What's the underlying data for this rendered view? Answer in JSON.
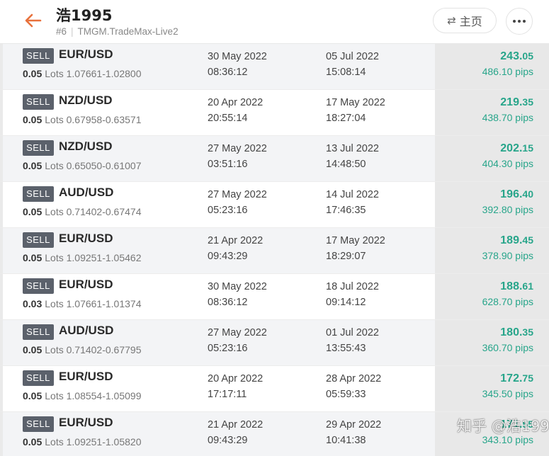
{
  "header": {
    "title": "浩1995",
    "account_id": "#6",
    "server": "TMGM.TradeMax-Live2",
    "home_label": "主页"
  },
  "trades": [
    {
      "side": "SELL",
      "pair": "EUR/USD",
      "lots": "0.05",
      "lots_label": "Lots",
      "prices": "1.07661-1.02800",
      "open_date": "30 May 2022",
      "open_time": "08:36:12",
      "close_date": "05 Jul 2022",
      "close_time": "15:08:14",
      "profit_int": "243.",
      "profit_dec": "05",
      "pips": "486.10 pips"
    },
    {
      "side": "SELL",
      "pair": "NZD/USD",
      "lots": "0.05",
      "lots_label": "Lots",
      "prices": "0.67958-0.63571",
      "open_date": "20 Apr 2022",
      "open_time": "20:55:14",
      "close_date": "17 May 2022",
      "close_time": "18:27:04",
      "profit_int": "219.",
      "profit_dec": "35",
      "pips": "438.70 pips"
    },
    {
      "side": "SELL",
      "pair": "NZD/USD",
      "lots": "0.05",
      "lots_label": "Lots",
      "prices": "0.65050-0.61007",
      "open_date": "27 May 2022",
      "open_time": "03:51:16",
      "close_date": "13 Jul 2022",
      "close_time": "14:48:50",
      "profit_int": "202.",
      "profit_dec": "15",
      "pips": "404.30 pips"
    },
    {
      "side": "SELL",
      "pair": "AUD/USD",
      "lots": "0.05",
      "lots_label": "Lots",
      "prices": "0.71402-0.67474",
      "open_date": "27 May 2022",
      "open_time": "05:23:16",
      "close_date": "14 Jul 2022",
      "close_time": "17:46:35",
      "profit_int": "196.",
      "profit_dec": "40",
      "pips": "392.80 pips"
    },
    {
      "side": "SELL",
      "pair": "EUR/USD",
      "lots": "0.05",
      "lots_label": "Lots",
      "prices": "1.09251-1.05462",
      "open_date": "21 Apr 2022",
      "open_time": "09:43:29",
      "close_date": "17 May 2022",
      "close_time": "18:29:07",
      "profit_int": "189.",
      "profit_dec": "45",
      "pips": "378.90 pips"
    },
    {
      "side": "SELL",
      "pair": "EUR/USD",
      "lots": "0.03",
      "lots_label": "Lots",
      "prices": "1.07661-1.01374",
      "open_date": "30 May 2022",
      "open_time": "08:36:12",
      "close_date": "18 Jul 2022",
      "close_time": "09:14:12",
      "profit_int": "188.",
      "profit_dec": "61",
      "pips": "628.70 pips"
    },
    {
      "side": "SELL",
      "pair": "AUD/USD",
      "lots": "0.05",
      "lots_label": "Lots",
      "prices": "0.71402-0.67795",
      "open_date": "27 May 2022",
      "open_time": "05:23:16",
      "close_date": "01 Jul 2022",
      "close_time": "13:55:43",
      "profit_int": "180.",
      "profit_dec": "35",
      "pips": "360.70 pips"
    },
    {
      "side": "SELL",
      "pair": "EUR/USD",
      "lots": "0.05",
      "lots_label": "Lots",
      "prices": "1.08554-1.05099",
      "open_date": "20 Apr 2022",
      "open_time": "17:17:11",
      "close_date": "28 Apr 2022",
      "close_time": "05:59:33",
      "profit_int": "172.",
      "profit_dec": "75",
      "pips": "345.50 pips"
    },
    {
      "side": "SELL",
      "pair": "EUR/USD",
      "lots": "0.05",
      "lots_label": "Lots",
      "prices": "1.09251-1.05820",
      "open_date": "21 Apr 2022",
      "open_time": "09:43:29",
      "close_date": "29 Apr 2022",
      "close_time": "10:41:38",
      "profit_int": "171.",
      "profit_dec": "55",
      "pips": "343.10 pips"
    }
  ],
  "watermark": "知乎 @浩1995",
  "colors": {
    "profit": "#27a58a",
    "badge": "#5b616b",
    "accent": "#e8713c"
  },
  "icons": {
    "back": "arrow-left-icon",
    "home": "swap-icon",
    "more": "more-dots-icon"
  }
}
